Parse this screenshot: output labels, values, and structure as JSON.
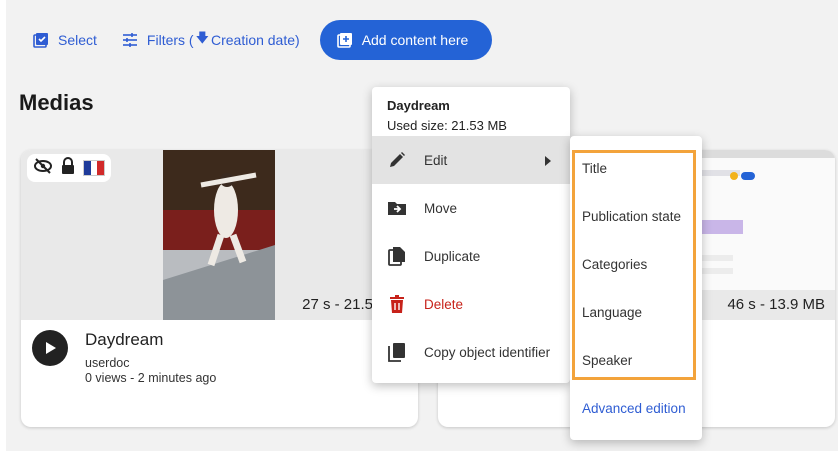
{
  "toolbar": {
    "select_label": "Select",
    "filters_label": "Filters (",
    "filters_sort": "Creation date)",
    "add_label": "Add content here"
  },
  "page": {
    "title": "Medias"
  },
  "cards": [
    {
      "title": "Daydream",
      "author": "userdoc",
      "stats": "0 views  - 2 minutes ago",
      "duration": "27 s - 21.53 MB"
    },
    {
      "duration": "46 s - 13.9 MB"
    }
  ],
  "context_menu": {
    "title": "Daydream",
    "subtitle": "Used size: 21.53 MB",
    "items": [
      {
        "label": "Edit",
        "icon": "pencil-icon"
      },
      {
        "label": "Move",
        "icon": "folder-move-icon"
      },
      {
        "label": "Duplicate",
        "icon": "duplicate-icon"
      },
      {
        "label": "Delete",
        "icon": "trash-icon"
      },
      {
        "label": "Copy object identifier",
        "icon": "copy-icon"
      }
    ]
  },
  "edit_submenu": {
    "items": [
      "Title",
      "Publication state",
      "Categories",
      "Language",
      "Speaker"
    ],
    "advanced": "Advanced edition"
  },
  "colors": {
    "accent": "#2463d6",
    "danger": "#c7221a",
    "highlight": "#f3a33b"
  }
}
